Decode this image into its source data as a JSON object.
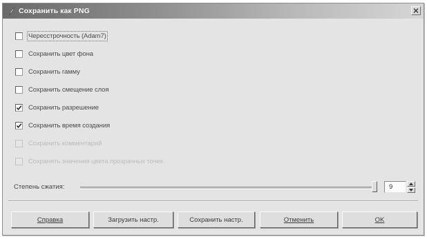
{
  "window": {
    "title": "Сохранить как PNG",
    "title_icon": "app-feather-icon",
    "close_icon": "close-icon"
  },
  "options": [
    {
      "label": "Чересстрочность (Adam7)",
      "checked": false,
      "enabled": true,
      "focused": true
    },
    {
      "label": "Сохранить цвет фона",
      "checked": false,
      "enabled": true,
      "focused": false
    },
    {
      "label": "Сохранить гамму",
      "checked": false,
      "enabled": true,
      "focused": false
    },
    {
      "label": "Сохранить смещение слоя",
      "checked": false,
      "enabled": true,
      "focused": false
    },
    {
      "label": "Сохранить разрешение",
      "checked": true,
      "enabled": true,
      "focused": false
    },
    {
      "label": "Сохранить время создания",
      "checked": true,
      "enabled": true,
      "focused": false
    },
    {
      "label": "Сохранить комментарий",
      "checked": false,
      "enabled": false,
      "focused": false
    },
    {
      "label": "Сохранять значения цвета прозрачных точек",
      "checked": false,
      "enabled": false,
      "focused": false
    }
  ],
  "compression": {
    "label": "Степень сжатия:",
    "value": "9",
    "level": 9,
    "max": 9
  },
  "buttons": {
    "help": "Справка",
    "load_defaults": "Загрузить настр.",
    "save_defaults": "Сохранить настр.",
    "cancel": "Отменить",
    "ok": "OK"
  },
  "colors": {
    "dialog_bg": "#e4e4e4",
    "titlebar_dark": "#6a6a6a",
    "titlebar_light": "#d6d6d6"
  }
}
